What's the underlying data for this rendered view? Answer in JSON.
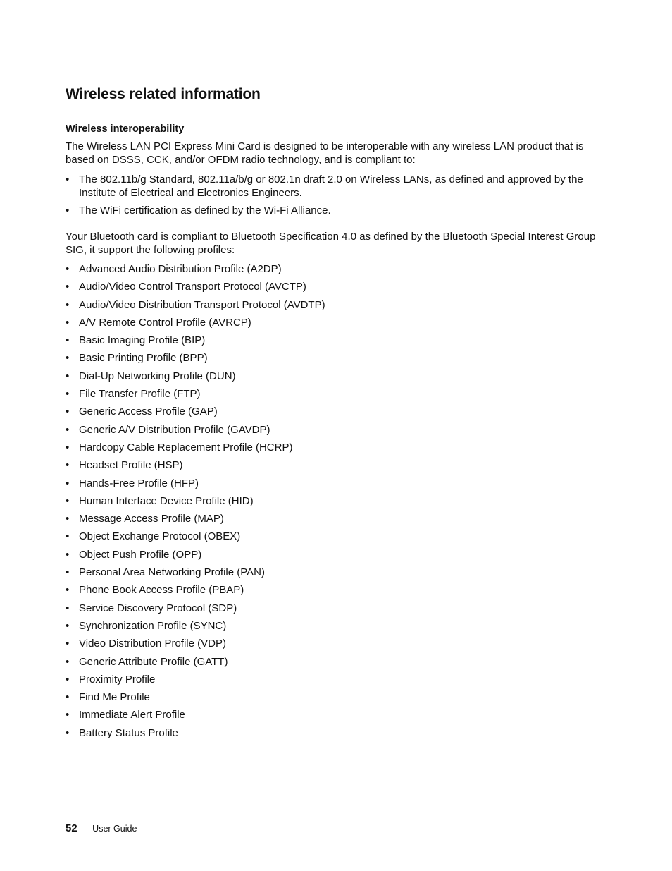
{
  "section_title": "Wireless related information",
  "subsection_title": "Wireless interoperability",
  "intro_paragraph": "The Wireless LAN PCI Express Mini Card is designed to be interoperable with any wireless LAN product that is based on DSSS, CCK, and/or OFDM radio technology, and is compliant to:",
  "wifi_compliance": [
    "The 802.11b/g Standard, 802.11a/b/g or 802.1n draft 2.0 on Wireless LANs, as defined and approved by the Institute of Electrical and Electronics Engineers.",
    "The WiFi certification as defined by the Wi-Fi Alliance."
  ],
  "bluetooth_paragraph": "Your Bluetooth card is compliant to Bluetooth Specification 4.0 as defined by the Bluetooth Special Interest Group SIG, it support the following profiles:",
  "bluetooth_profiles": [
    "Advanced Audio Distribution Profile (A2DP)",
    "Audio/Video Control Transport Protocol (AVCTP)",
    "Audio/Video Distribution Transport Protocol (AVDTP)",
    "A/V Remote Control Profile (AVRCP)",
    "Basic Imaging Profile (BIP)",
    "Basic Printing Profile (BPP)",
    "Dial-Up Networking Profile (DUN)",
    "File Transfer Profile (FTP)",
    "Generic Access Profile (GAP)",
    "Generic A/V Distribution Profile (GAVDP)",
    "Hardcopy Cable Replacement Profile (HCRP)",
    "Headset Profile (HSP)",
    "Hands-Free Profile (HFP)",
    "Human Interface Device Profile (HID)",
    "Message Access Profile (MAP)",
    "Object Exchange Protocol (OBEX)",
    "Object Push Profile (OPP)",
    "Personal Area Networking Profile (PAN)",
    "Phone Book Access Profile (PBAP)",
    "Service Discovery Protocol (SDP)",
    "Synchronization Profile (SYNC)",
    "Video Distribution Profile (VDP)",
    "Generic Attribute Profile (GATT)",
    "Proximity Profile",
    "Find Me Profile",
    "Immediate Alert Profile",
    "Battery Status Profile"
  ],
  "bullet_glyph": "•",
  "footer": {
    "page_number": "52",
    "document_title": "User Guide"
  }
}
